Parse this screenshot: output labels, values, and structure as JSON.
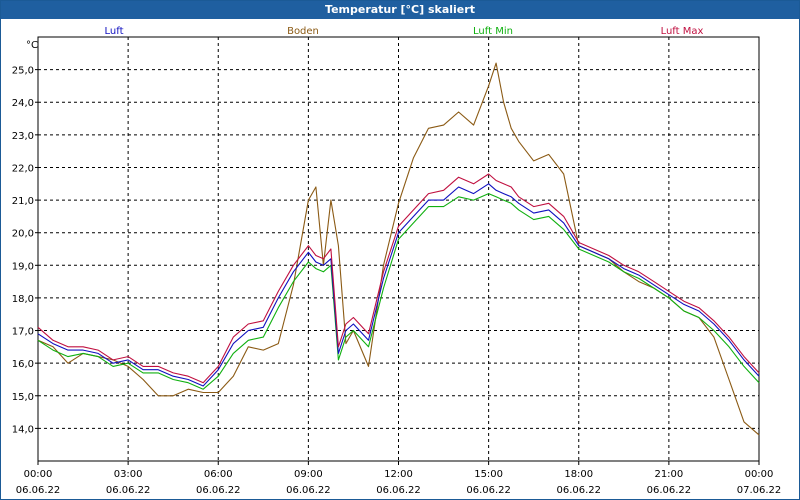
{
  "window": {
    "title": "Temperatur [°C] skaliert"
  },
  "chart_data": {
    "type": "line",
    "title": "Temperatur [°C] skaliert",
    "ylabel": "°C",
    "xlabel": "",
    "ylim": [
      13.0,
      26.0
    ],
    "y_ticks": [
      "14,0",
      "15,0",
      "16,0",
      "17,0",
      "18,0",
      "19,0",
      "20,0",
      "21,0",
      "22,0",
      "23,0",
      "24,0",
      "25,0"
    ],
    "x_ticks": [
      {
        "time": "00:00",
        "date": "06.06.22"
      },
      {
        "time": "03:00",
        "date": "06.06.22"
      },
      {
        "time": "06:00",
        "date": "06.06.22"
      },
      {
        "time": "09:00",
        "date": "06.06.22"
      },
      {
        "time": "12:00",
        "date": "06.06.22"
      },
      {
        "time": "15:00",
        "date": "06.06.22"
      },
      {
        "time": "18:00",
        "date": "06.06.22"
      },
      {
        "time": "21:00",
        "date": "06.06.22"
      },
      {
        "time": "00:00",
        "date": "07.06.22"
      }
    ],
    "grid": true,
    "legend_position": "top",
    "series": [
      {
        "name": "Luft",
        "color": "#1010c0",
        "x": [
          0,
          0.5,
          1,
          1.5,
          2,
          2.5,
          3,
          3.5,
          4,
          4.5,
          5,
          5.5,
          6,
          6.5,
          7,
          7.5,
          8,
          8.5,
          9,
          9.25,
          9.5,
          9.75,
          10,
          10.25,
          10.5,
          11,
          11.5,
          12,
          12.5,
          13,
          13.5,
          14,
          14.5,
          15,
          15.25,
          15.5,
          15.75,
          16,
          16.5,
          17,
          17.5,
          18,
          18.5,
          19,
          19.5,
          20,
          20.5,
          21,
          21.5,
          22,
          22.5,
          23,
          23.5,
          24
        ],
        "y": [
          16.9,
          16.6,
          16.4,
          16.4,
          16.3,
          16.0,
          16.1,
          15.8,
          15.8,
          15.6,
          15.5,
          15.3,
          15.8,
          16.6,
          17.0,
          17.1,
          18.0,
          18.8,
          19.4,
          19.1,
          19.0,
          19.2,
          16.3,
          17.0,
          17.2,
          16.7,
          18.6,
          20.0,
          20.5,
          21.0,
          21.0,
          21.4,
          21.2,
          21.5,
          21.3,
          21.2,
          21.1,
          20.9,
          20.6,
          20.7,
          20.3,
          19.6,
          19.4,
          19.2,
          18.9,
          18.7,
          18.4,
          18.1,
          17.8,
          17.6,
          17.2,
          16.7,
          16.1,
          15.6
        ]
      },
      {
        "name": "Boden",
        "color": "#8b5a14",
        "x": [
          0,
          0.5,
          1,
          1.5,
          2,
          2.5,
          3,
          3.5,
          4,
          4.5,
          5,
          5.5,
          6,
          6.5,
          7,
          7.5,
          8,
          8.5,
          9,
          9.25,
          9.5,
          9.75,
          10,
          10.25,
          10.5,
          11,
          11.5,
          12,
          12.5,
          13,
          13.5,
          14,
          14.5,
          15,
          15.25,
          15.5,
          15.75,
          16,
          16.5,
          17,
          17.5,
          18,
          18.5,
          19,
          19.5,
          20,
          20.5,
          21,
          21.5,
          22,
          22.5,
          23,
          23.5,
          24
        ],
        "y": [
          16.7,
          16.5,
          16.0,
          16.3,
          16.2,
          16.1,
          15.9,
          15.5,
          15.0,
          15.0,
          15.2,
          15.1,
          15.1,
          15.6,
          16.5,
          16.4,
          16.6,
          18.4,
          21.0,
          21.4,
          19.0,
          21.0,
          19.6,
          16.6,
          17.0,
          15.9,
          19.0,
          20.9,
          22.3,
          23.2,
          23.3,
          23.7,
          23.3,
          24.5,
          25.2,
          24.0,
          23.2,
          22.8,
          22.2,
          22.4,
          21.8,
          19.6,
          19.4,
          19.2,
          18.8,
          18.5,
          18.3,
          18.0,
          17.6,
          17.4,
          16.8,
          15.5,
          14.2,
          13.8
        ]
      },
      {
        "name": "Luft Min",
        "color": "#10b010",
        "x": [
          0,
          0.5,
          1,
          1.5,
          2,
          2.5,
          3,
          3.5,
          4,
          4.5,
          5,
          5.5,
          6,
          6.5,
          7,
          7.5,
          8,
          8.5,
          9,
          9.25,
          9.5,
          9.75,
          10,
          10.25,
          10.5,
          11,
          11.5,
          12,
          12.5,
          13,
          13.5,
          14,
          14.5,
          15,
          15.25,
          15.5,
          15.75,
          16,
          16.5,
          17,
          17.5,
          18,
          18.5,
          19,
          19.5,
          20,
          20.5,
          21,
          21.5,
          22,
          22.5,
          23,
          23.5,
          24
        ],
        "y": [
          16.7,
          16.4,
          16.2,
          16.3,
          16.2,
          15.9,
          16.0,
          15.7,
          15.7,
          15.5,
          15.4,
          15.2,
          15.6,
          16.3,
          16.7,
          16.8,
          17.7,
          18.5,
          19.1,
          18.9,
          18.8,
          19.0,
          16.1,
          16.8,
          17.0,
          16.5,
          18.3,
          19.8,
          20.3,
          20.8,
          20.8,
          21.1,
          21.0,
          21.2,
          21.1,
          21.0,
          20.9,
          20.7,
          20.4,
          20.5,
          20.1,
          19.5,
          19.3,
          19.1,
          18.8,
          18.6,
          18.3,
          18.0,
          17.6,
          17.4,
          17.0,
          16.5,
          15.9,
          15.4
        ]
      },
      {
        "name": "Luft Max",
        "color": "#c01040",
        "x": [
          0,
          0.5,
          1,
          1.5,
          2,
          2.5,
          3,
          3.5,
          4,
          4.5,
          5,
          5.5,
          6,
          6.5,
          7,
          7.5,
          8,
          8.5,
          9,
          9.25,
          9.5,
          9.75,
          10,
          10.25,
          10.5,
          11,
          11.5,
          12,
          12.5,
          13,
          13.5,
          14,
          14.5,
          15,
          15.25,
          15.5,
          15.75,
          16,
          16.5,
          17,
          17.5,
          18,
          18.5,
          19,
          19.5,
          20,
          20.5,
          21,
          21.5,
          22,
          22.5,
          23,
          23.5,
          24
        ],
        "y": [
          17.1,
          16.7,
          16.5,
          16.5,
          16.4,
          16.1,
          16.2,
          15.9,
          15.9,
          15.7,
          15.6,
          15.4,
          15.9,
          16.8,
          17.2,
          17.3,
          18.2,
          19.0,
          19.6,
          19.3,
          19.2,
          19.5,
          16.5,
          17.2,
          17.4,
          16.9,
          18.8,
          20.2,
          20.7,
          21.2,
          21.3,
          21.7,
          21.5,
          21.8,
          21.6,
          21.5,
          21.4,
          21.1,
          20.8,
          20.9,
          20.5,
          19.7,
          19.5,
          19.3,
          19.0,
          18.8,
          18.5,
          18.2,
          17.9,
          17.7,
          17.3,
          16.8,
          16.2,
          15.7
        ]
      }
    ]
  }
}
